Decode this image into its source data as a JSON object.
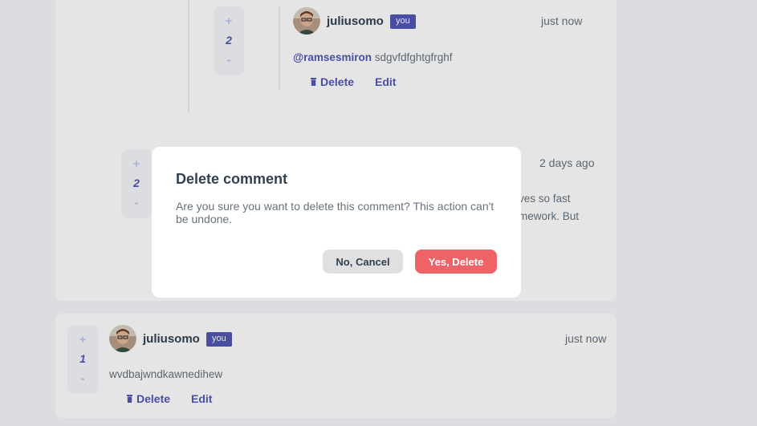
{
  "comments": [
    {
      "votes": {
        "plus": "+",
        "count": "2",
        "minus": "-"
      },
      "username": "juliusomo",
      "you_badge": "you",
      "timestamp": "just now",
      "mention": "@ramsesmiron",
      "text": "sdgvfdfghtgfrghf",
      "actions": {
        "delete": "Delete",
        "edit": "Edit"
      }
    },
    {
      "votes": {
        "plus": "+",
        "count": "2",
        "minus": "-"
      },
      "timestamp": "2 days ago",
      "text_line1": "ves so fast",
      "text_line2": "mework. But"
    },
    {
      "votes": {
        "plus": "+",
        "count": "1",
        "minus": "-"
      },
      "username": "juliusomo",
      "you_badge": "you",
      "timestamp": "just now",
      "text": "wvdbajwndkawnedihew",
      "actions": {
        "delete": "Delete",
        "edit": "Edit"
      }
    }
  ],
  "modal": {
    "title": "Delete comment",
    "text": "Are you sure you want to delete this comment? This action can't be undone.",
    "cancel_label": "No, Cancel",
    "confirm_label": "Yes, Delete"
  },
  "icons": {
    "avatar": "avatar-image",
    "delete": "trash-icon"
  },
  "colors": {
    "background": "#f5f6fa",
    "card": "#ffffff",
    "primary": "#5357b6",
    "text": "#67727e",
    "heading": "#324152",
    "danger": "#ed6368",
    "neutral": "#e0e0e0"
  }
}
